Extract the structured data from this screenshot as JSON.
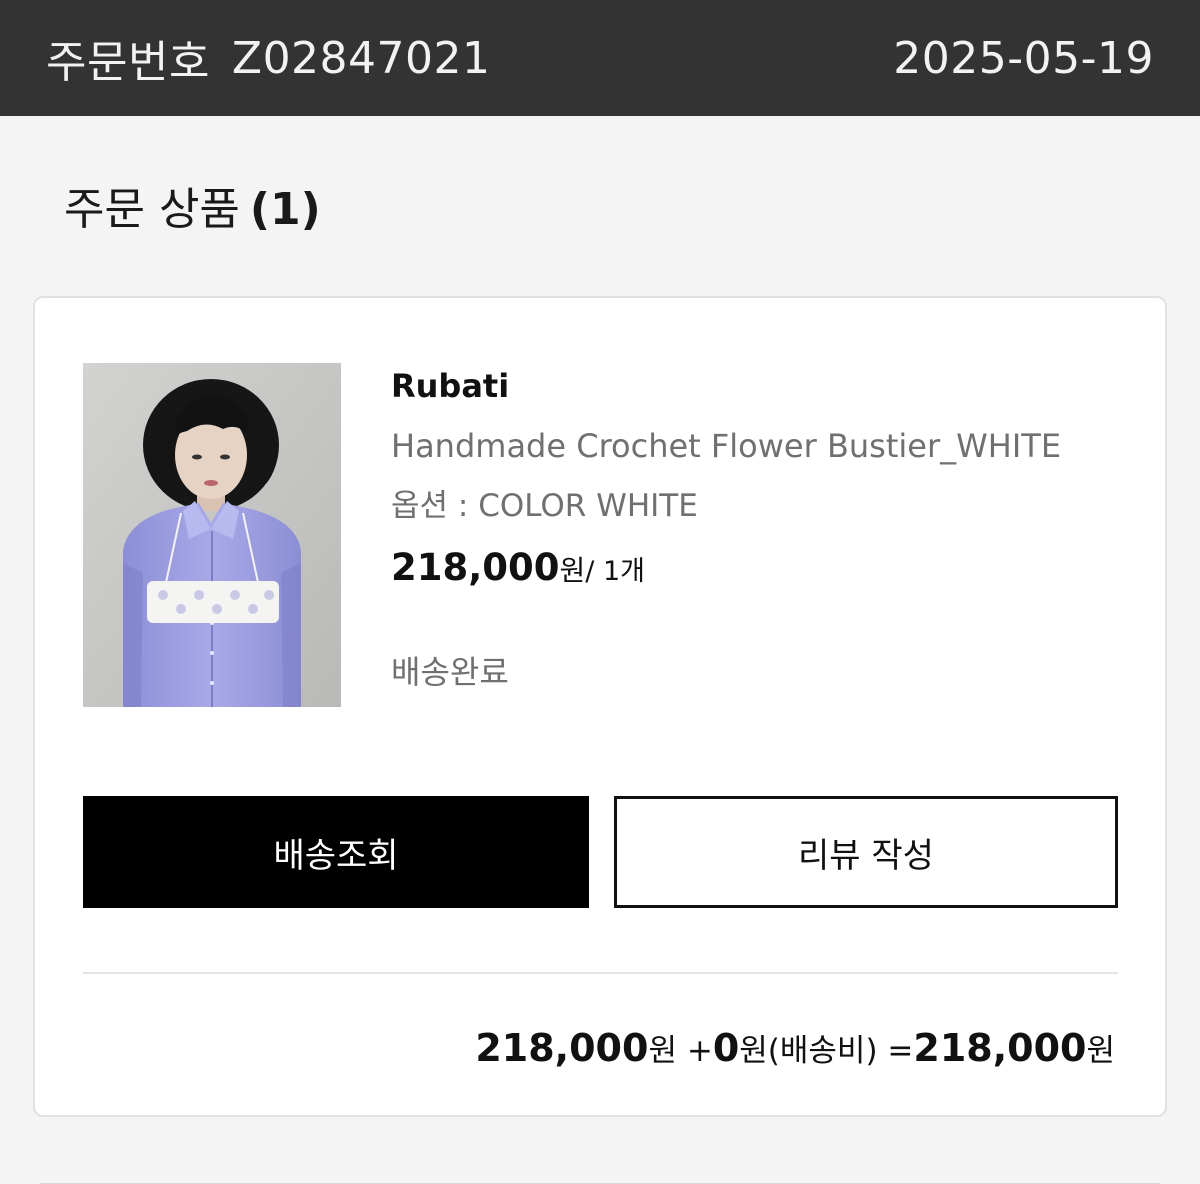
{
  "header": {
    "order_label": "주문번호",
    "order_number": "Z02847021",
    "order_date": "2025-05-19"
  },
  "section": {
    "title": "주문 상품",
    "count": "(1)"
  },
  "item": {
    "brand": "Rubati",
    "product_name": "Handmade Crochet Flower Bustier_WHITE",
    "option": "옵션 : COLOR WHITE",
    "price": "218,000",
    "price_unit": "원",
    "quantity": "/ 1개",
    "status": "배송완료"
  },
  "buttons": {
    "track_delivery": "배송조회",
    "write_review": "리뷰 작성"
  },
  "summary": {
    "item_total": "218,000",
    "unit": "원",
    "plus": " +",
    "shipping": "0",
    "shipping_label": "(배송비)",
    "equals": " =",
    "grand_total": "218,000"
  },
  "colors": {
    "header_bg": "#333333",
    "primary_button_bg": "#000000",
    "page_bg": "#f4f4f4"
  }
}
